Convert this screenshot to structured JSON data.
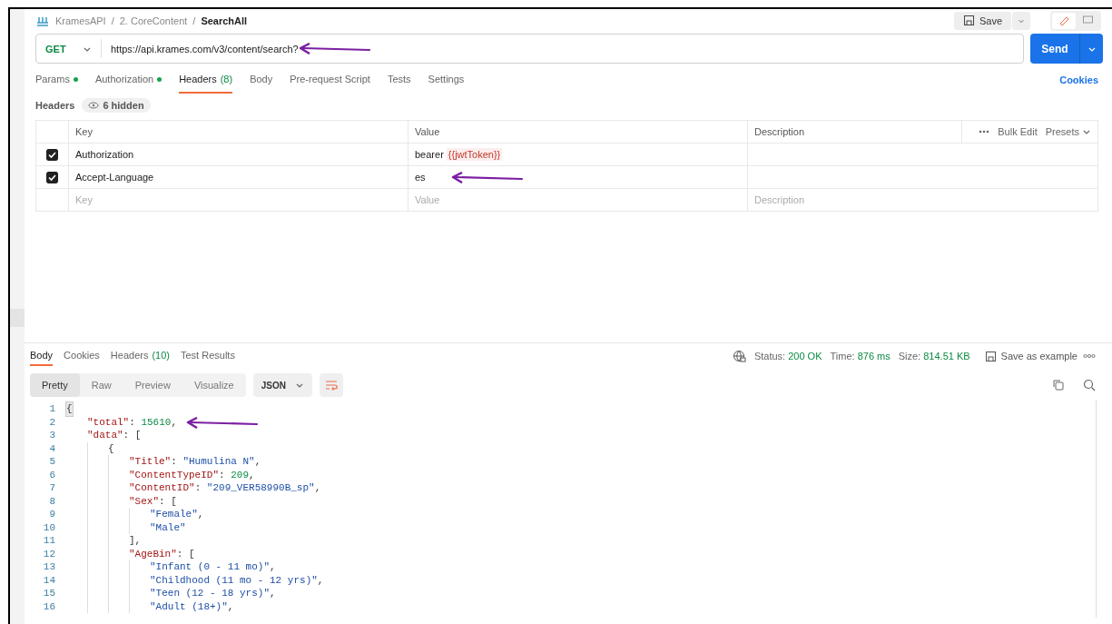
{
  "breadcrumb": [
    {
      "kind": "crumb",
      "text": "KramesAPI"
    },
    {
      "kind": "sep",
      "text": "/"
    },
    {
      "kind": "crumb",
      "text": "2. CoreContent"
    },
    {
      "kind": "sep",
      "text": "/"
    },
    {
      "kind": "current",
      "text": "SearchAll"
    }
  ],
  "save_button": {
    "label": "Save"
  },
  "request": {
    "method": "GET",
    "url": "https://api.krames.com/v3/content/search?",
    "send_label": "Send"
  },
  "request_tabs": [
    {
      "label": "Params",
      "dot": true,
      "selected": false
    },
    {
      "label": "Authorization",
      "dot": true,
      "selected": false
    },
    {
      "label": "Headers",
      "count": "(8)",
      "dot": false,
      "selected": true
    },
    {
      "label": "Body",
      "dot": false,
      "selected": false
    },
    {
      "label": "Pre-request Script",
      "dot": false,
      "selected": false
    },
    {
      "label": "Tests",
      "dot": false,
      "selected": false
    },
    {
      "label": "Settings",
      "dot": false,
      "selected": false
    }
  ],
  "cookies_link": "Cookies",
  "headers_section": {
    "title": "Headers",
    "hidden_badge": "6 hidden"
  },
  "headers_table": {
    "columns": [
      "Key",
      "Value",
      "Description"
    ],
    "bulk_edit": "Bulk Edit",
    "presets": "Presets",
    "rows": [
      {
        "checked": true,
        "key": "Authorization",
        "value": "bearer",
        "variable": "{{jwtToken}}"
      },
      {
        "checked": true,
        "key": "Accept-Language",
        "value": "es"
      }
    ],
    "placeholders": {
      "key": "Key",
      "value": "Value",
      "description": "Description"
    }
  },
  "response_tabs": [
    {
      "label": "Body",
      "selected": true
    },
    {
      "label": "Cookies",
      "selected": false
    },
    {
      "label": "Headers",
      "count": "(10)",
      "selected": false
    },
    {
      "label": "Test Results",
      "selected": false
    }
  ],
  "response_status": {
    "status_label": "Status:",
    "status": "200 OK",
    "time_label": "Time:",
    "time": "876 ms",
    "size_label": "Size:",
    "size": "814.51 KB"
  },
  "save_example": "Save as example",
  "view_modes": [
    {
      "label": "Pretty",
      "selected": true
    },
    {
      "label": "Raw",
      "selected": false
    },
    {
      "label": "Preview",
      "selected": false
    },
    {
      "label": "Visualize",
      "selected": false
    }
  ],
  "format": "JSON",
  "code_lines": [
    {
      "n": "1",
      "tokens": [
        {
          "kind": "punct",
          "text": "{"
        }
      ],
      "children": [
        {
          "n": "2",
          "tokens": [
            {
              "kind": "key",
              "text": "\"total\""
            },
            {
              "kind": "punct",
              "text": ": "
            },
            {
              "kind": "num",
              "text": "15610"
            },
            {
              "kind": "punct",
              "text": ","
            }
          ]
        },
        {
          "n": "3",
          "tokens": [
            {
              "kind": "key",
              "text": "\"data\""
            },
            {
              "kind": "punct",
              "text": ": ["
            }
          ],
          "children": [
            {
              "n": "4",
              "tokens": [
                {
                  "kind": "punct",
                  "text": "{"
                }
              ],
              "children": [
                {
                  "n": "5",
                  "tokens": [
                    {
                      "kind": "key",
                      "text": "\"Title\""
                    },
                    {
                      "kind": "punct",
                      "text": ": "
                    },
                    {
                      "kind": "str",
                      "text": "\"Humulina N\""
                    },
                    {
                      "kind": "punct",
                      "text": ","
                    }
                  ]
                },
                {
                  "n": "6",
                  "tokens": [
                    {
                      "kind": "key",
                      "text": "\"ContentTypeID\""
                    },
                    {
                      "kind": "punct",
                      "text": ": "
                    },
                    {
                      "kind": "num",
                      "text": "209"
                    },
                    {
                      "kind": "punct",
                      "text": ","
                    }
                  ]
                },
                {
                  "n": "7",
                  "tokens": [
                    {
                      "kind": "key",
                      "text": "\"ContentID\""
                    },
                    {
                      "kind": "punct",
                      "text": ": "
                    },
                    {
                      "kind": "str",
                      "text": "\"209_VER58990B_sp\""
                    },
                    {
                      "kind": "punct",
                      "text": ","
                    }
                  ]
                },
                {
                  "n": "8",
                  "tokens": [
                    {
                      "kind": "key",
                      "text": "\"Sex\""
                    },
                    {
                      "kind": "punct",
                      "text": ": ["
                    }
                  ],
                  "children": [
                    {
                      "n": "9",
                      "tokens": [
                        {
                          "kind": "str",
                          "text": "\"Female\""
                        },
                        {
                          "kind": "punct",
                          "text": ","
                        }
                      ]
                    },
                    {
                      "n": "10",
                      "tokens": [
                        {
                          "kind": "str",
                          "text": "\"Male\""
                        }
                      ]
                    }
                  ]
                },
                {
                  "n": "11",
                  "tokens": [
                    {
                      "kind": "punct",
                      "text": "],"
                    }
                  ]
                },
                {
                  "n": "12",
                  "tokens": [
                    {
                      "kind": "key",
                      "text": "\"AgeBin\""
                    },
                    {
                      "kind": "punct",
                      "text": ": ["
                    }
                  ],
                  "children": [
                    {
                      "n": "13",
                      "tokens": [
                        {
                          "kind": "str",
                          "text": "\"Infant (0 - 11 mo)\""
                        },
                        {
                          "kind": "punct",
                          "text": ","
                        }
                      ]
                    },
                    {
                      "n": "14",
                      "tokens": [
                        {
                          "kind": "str",
                          "text": "\"Childhood (11 mo - 12 yrs)\""
                        },
                        {
                          "kind": "punct",
                          "text": ","
                        }
                      ]
                    },
                    {
                      "n": "15",
                      "tokens": [
                        {
                          "kind": "str",
                          "text": "\"Teen (12 - 18 yrs)\""
                        },
                        {
                          "kind": "punct",
                          "text": ","
                        }
                      ]
                    },
                    {
                      "n": "16",
                      "tokens": [
                        {
                          "kind": "str",
                          "text": "\"Adult (18+)\""
                        },
                        {
                          "kind": "punct",
                          "text": ","
                        }
                      ]
                    }
                  ]
                }
              ]
            }
          ]
        }
      ]
    }
  ]
}
